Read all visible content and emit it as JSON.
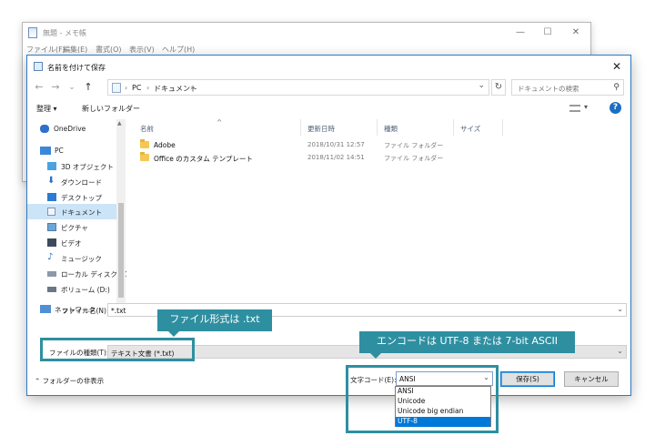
{
  "notepad": {
    "title": "無題 - メモ帳",
    "menu": [
      "ファイル(F)",
      "編集(E)",
      "書式(O)",
      "表示(V)",
      "ヘルプ(H)"
    ],
    "controls": [
      "—",
      "☐",
      "✕"
    ]
  },
  "dialog": {
    "title": "名前を付けて保存",
    "close": "✕",
    "nav": {
      "back": "←",
      "forward": "→",
      "recent": "⌄",
      "up": "↑"
    },
    "breadcrumb": [
      "PC",
      "ドキュメント"
    ],
    "refresh": "↻",
    "search_placeholder": "ドキュメントの検索",
    "toolbar": {
      "organize": "整理 ▾",
      "new_folder": "新しいフォルダー",
      "view_dd": "▾",
      "help": "?"
    },
    "sidebar": [
      {
        "label": "OneDrive",
        "icon": "onedrive-icon"
      },
      {
        "label": "PC",
        "icon": "pc-icon"
      },
      {
        "label": "3D オブジェクト",
        "icon": "3d-objects-icon"
      },
      {
        "label": "ダウンロード",
        "icon": "download-icon"
      },
      {
        "label": "デスクトップ",
        "icon": "desktop-icon"
      },
      {
        "label": "ドキュメント",
        "icon": "documents-icon",
        "selected": true
      },
      {
        "label": "ピクチャ",
        "icon": "pictures-icon"
      },
      {
        "label": "ビデオ",
        "icon": "videos-icon"
      },
      {
        "label": "ミュージック",
        "icon": "music-icon"
      },
      {
        "label": "ローカル ディスク (C",
        "icon": "local-disk-icon"
      },
      {
        "label": "ボリューム (D:)",
        "icon": "volume-icon"
      },
      {
        "label": "ネットワーク",
        "icon": "network-icon"
      }
    ],
    "columns": [
      "名前",
      "更新日時",
      "種類",
      "サイズ"
    ],
    "files": [
      {
        "name": "Adobe",
        "modified": "2018/10/31 12:57",
        "type": "ファイル フォルダー"
      },
      {
        "name": "Office のカスタム テンプレート",
        "modified": "2018/11/02 14:51",
        "type": "ファイル フォルダー"
      }
    ],
    "filename_label": "ファイル名(N):",
    "filename_value": "*.txt",
    "filetype_label": "ファイルの種類(T):",
    "filetype_value": "テキスト文書 (*.txt)",
    "hide_folders": "フォルダーの非表示",
    "encoding_label": "文字コード(E):",
    "encoding_value": "ANSI",
    "encoding_options": [
      "ANSI",
      "Unicode",
      "Unicode big endian",
      "UTF-8"
    ],
    "encoding_selected_option": "UTF-8",
    "save_button": "保存(S)",
    "cancel_button": "キャンセル"
  },
  "callouts": {
    "file_format": "ファイル形式は .txt",
    "encoding": "エンコードは UTF-8 または 7-bit ASCII"
  },
  "colors": {
    "accent": "#2e8fa1",
    "selection": "#0078d7",
    "window_border": "#2b79c7"
  }
}
